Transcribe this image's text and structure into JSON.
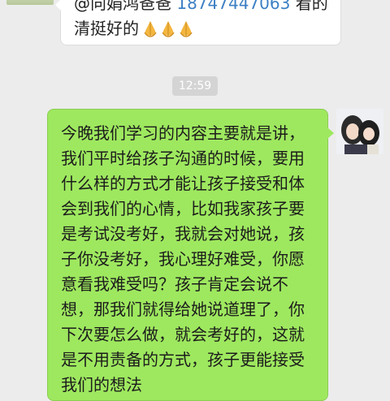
{
  "incoming_message": {
    "mention": "@向娟鸿爸爸",
    "phone": "18747447063",
    "text_tail": "看的",
    "line2": "清挺好的",
    "emoji_count": 3
  },
  "timestamp": "12:59",
  "outgoing_message": {
    "lines": [
      "今晚我们学习的内容主要就是讲，",
      "我们平时给孩子沟通的时候，要用",
      "什么样的方式才能让孩子接受和体",
      "会到我们的心情，比如我家孩子要",
      "是考试没考好，我就会对她说，孩",
      "子你没考好，我心理好难受，你愿",
      "意看我难受吗？孩子肯定会说不",
      "想，那我们就得给她说道理了，你",
      "下次要怎么做，就会考好的，这就",
      "是不用责备的方式，孩子更能接受",
      "我们的想法"
    ]
  },
  "colors": {
    "background": "#ececec",
    "outgoing_bubble": "#9ee85f",
    "incoming_bubble": "#ffffff",
    "phone_link": "#3c7fc4",
    "time_pill": "#d4d4d4"
  },
  "icons": [
    "pray-hands-emoji"
  ]
}
